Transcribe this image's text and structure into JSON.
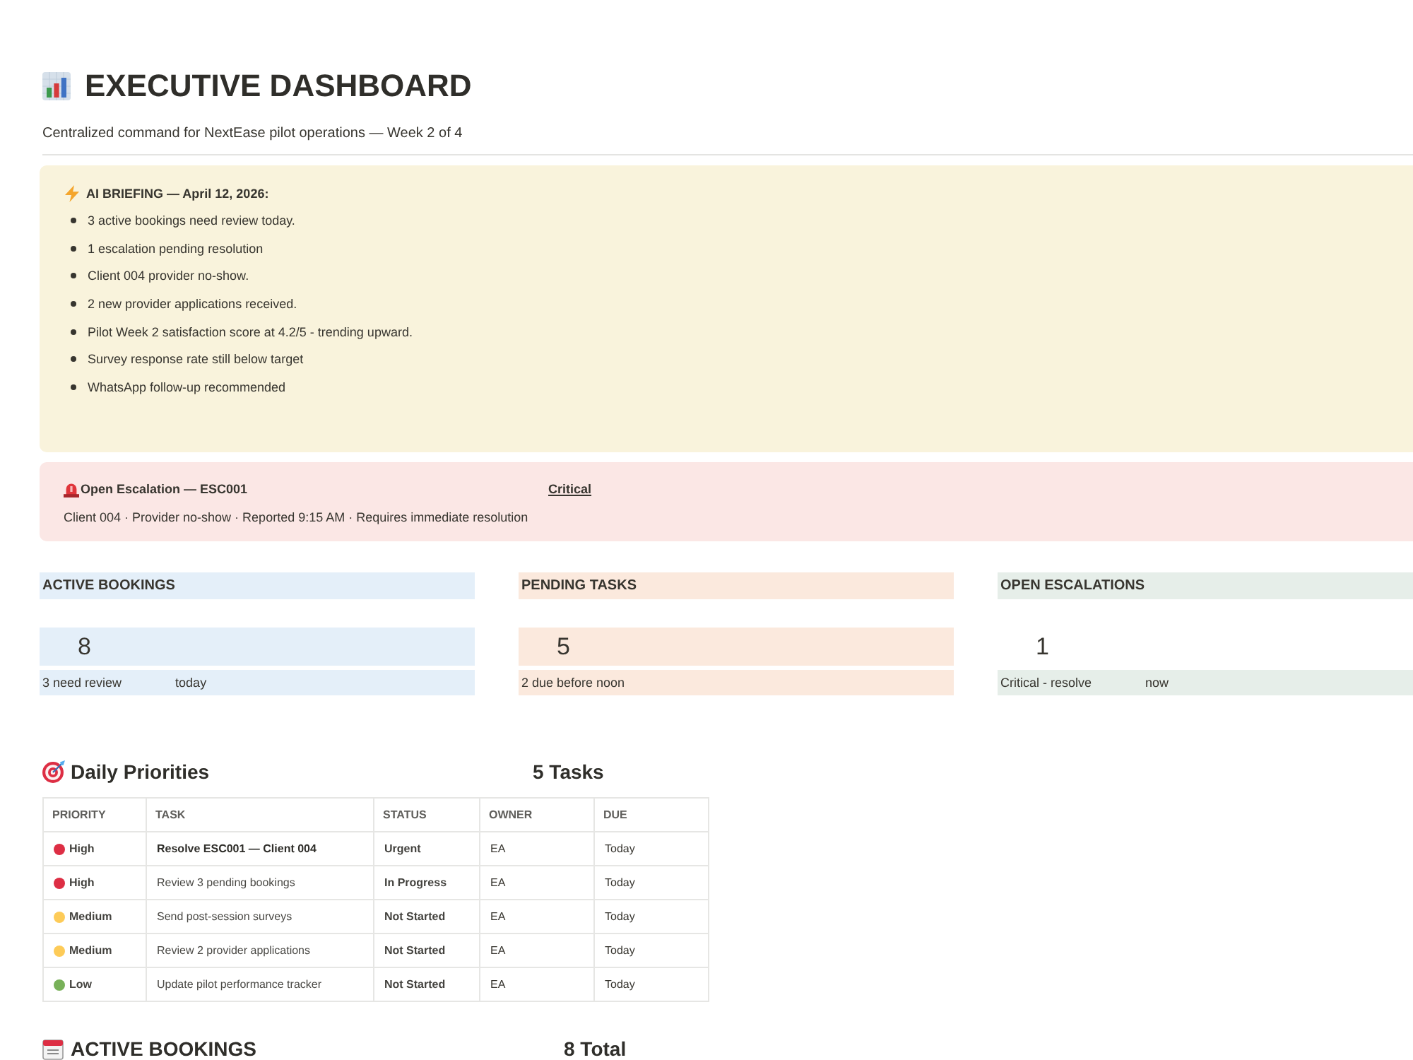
{
  "page": {
    "title": "EXECUTIVE DASHBOARD",
    "subtitle": "Centralized command for NextEase pilot operations — Week 2 of 4"
  },
  "briefing": {
    "heading": "AI BRIEFING — April 12, 2026:",
    "items": [
      "3 active bookings need review today.",
      "1 escalation pending resolution",
      "Client 004 provider no-show.",
      "2 new provider applications received.",
      "Pilot Week 2 satisfaction score at 4.2/5 - trending upward.",
      "Survey response rate still below target",
      "WhatsApp follow-up recommended"
    ]
  },
  "escalation": {
    "title": "Open Escalation — ESC001",
    "severity": "Critical",
    "details": "Client 004 · Provider no-show · Reported 9:15 AM · Requires immediate resolution"
  },
  "stat_cards": [
    {
      "label": "ACTIVE BOOKINGS",
      "value": "8",
      "value_filled": true,
      "note": [
        "3 need review",
        "today"
      ],
      "color": "#e4eff9"
    },
    {
      "label": "PENDING TASKS",
      "value": "5",
      "value_filled": true,
      "note": [
        "2 due before noon"
      ],
      "color": "#fbe9dd"
    },
    {
      "label": "OPEN ESCALATIONS",
      "value": "1",
      "value_filled": false,
      "note": [
        "Critical - resolve",
        "now"
      ],
      "color": "#e6eee9"
    }
  ],
  "daily_priorities": {
    "title": "Daily Priorities",
    "count": "5 Tasks",
    "columns": [
      "PRIORITY",
      "TASK",
      "STATUS",
      "OWNER",
      "DUE"
    ],
    "rows": [
      {
        "priority": "High",
        "color": "#dd2e44",
        "task": "Resolve ESC001 — Client 004",
        "task_bold": true,
        "status": "Urgent",
        "owner": "EA",
        "due": "Today"
      },
      {
        "priority": "High",
        "color": "#dd2e44",
        "task": "Review 3 pending bookings",
        "task_bold": false,
        "status": "In Progress",
        "owner": "EA",
        "due": "Today"
      },
      {
        "priority": "Medium",
        "color": "#fdcb58",
        "task": "Send post-session surveys",
        "task_bold": false,
        "status": "Not Started",
        "owner": "EA",
        "due": "Today"
      },
      {
        "priority": "Medium",
        "color": "#fdcb58",
        "task": "Review 2 provider applications",
        "task_bold": false,
        "status": "Not Started",
        "owner": "EA",
        "due": "Today"
      },
      {
        "priority": "Low",
        "color": "#78b159",
        "task": "Update pilot performance tracker",
        "task_bold": false,
        "status": "Not Started",
        "owner": "EA",
        "due": "Today"
      }
    ]
  },
  "active_bookings": {
    "title": "ACTIVE BOOKINGS",
    "count": "8 Total"
  }
}
